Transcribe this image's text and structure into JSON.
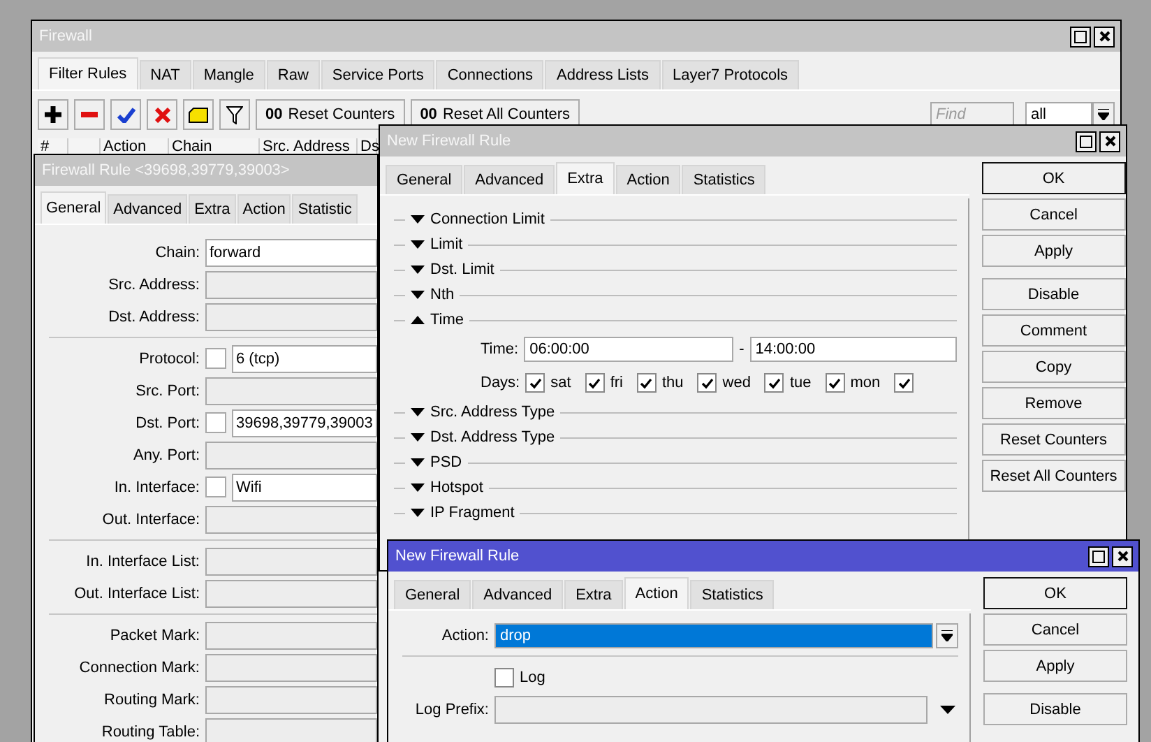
{
  "firewall": {
    "title": "Firewall",
    "tabs": [
      {
        "label": "Filter Rules",
        "selected": true
      },
      {
        "label": "NAT",
        "selected": false
      },
      {
        "label": "Mangle",
        "selected": false
      },
      {
        "label": "Raw",
        "selected": false
      },
      {
        "label": "Service Ports",
        "selected": false
      },
      {
        "label": "Connections",
        "selected": false
      },
      {
        "label": "Address Lists",
        "selected": false
      },
      {
        "label": "Layer7 Protocols",
        "selected": false
      }
    ],
    "toolbar": [
      {
        "kind": "add"
      },
      {
        "kind": "remove"
      },
      {
        "kind": "enable"
      },
      {
        "kind": "disable"
      },
      {
        "kind": "comment"
      },
      {
        "kind": "filter"
      },
      {
        "kind": "text",
        "icon_text": "00",
        "label": "Reset Counters"
      },
      {
        "kind": "text",
        "icon_text": "00",
        "label": "Reset All Counters"
      }
    ],
    "search": {
      "placeholder": "Find"
    },
    "filter_select": {
      "value": "all"
    },
    "table": {
      "columns": [
        "#",
        "Action",
        "Chain",
        "Src. Address",
        "Ds"
      ]
    }
  },
  "rule_window": {
    "title": "Firewall Rule <39698,39779,39003>",
    "tabs": [
      {
        "label": "General",
        "selected": true
      },
      {
        "label": "Advanced",
        "selected": false
      },
      {
        "label": "Extra",
        "selected": false
      },
      {
        "label": "Action",
        "selected": false
      },
      {
        "label": "Statistic",
        "selected": false
      }
    ],
    "groups": [
      [
        {
          "label": "Chain:",
          "value": "forward"
        },
        {
          "label": "Src. Address:"
        },
        {
          "label": "Dst. Address:"
        }
      ],
      [
        {
          "label": "Protocol:",
          "negated": false,
          "value": "6 (tcp)"
        },
        {
          "label": "Src. Port:"
        },
        {
          "label": "Dst. Port:",
          "negated": false,
          "value": "39698,39779,39003"
        },
        {
          "label": "Any. Port:"
        },
        {
          "label": "In. Interface:",
          "negated": false,
          "value": "Wifi"
        },
        {
          "label": "Out. Interface:"
        }
      ],
      [
        {
          "label": "In. Interface List:"
        },
        {
          "label": "Out. Interface List:"
        }
      ],
      [
        {
          "label": "Packet Mark:"
        },
        {
          "label": "Connection Mark:"
        },
        {
          "label": "Routing Mark:"
        },
        {
          "label": "Routing Table:"
        }
      ]
    ]
  },
  "extra_window": {
    "title": "New Firewall Rule",
    "tabs": [
      {
        "label": "General",
        "selected": false
      },
      {
        "label": "Advanced",
        "selected": false
      },
      {
        "label": "Extra",
        "selected": true
      },
      {
        "label": "Action",
        "selected": false
      },
      {
        "label": "Statistics",
        "selected": false
      }
    ],
    "sections": [
      {
        "label": "Connection Limit",
        "expanded": false
      },
      {
        "label": "Limit",
        "expanded": false
      },
      {
        "label": "Dst. Limit",
        "expanded": false
      },
      {
        "label": "Nth",
        "expanded": false
      },
      {
        "label": "Time",
        "expanded": true,
        "time": {
          "label": "Time:",
          "from": "06:00:00",
          "separator": "-",
          "to": "14:00:00"
        },
        "days": {
          "label": "Days:",
          "items": [
            {
              "label": "sat",
              "checked": true
            },
            {
              "label": "fri",
              "checked": true
            },
            {
              "label": "thu",
              "checked": true
            },
            {
              "label": "wed",
              "checked": true
            },
            {
              "label": "tue",
              "checked": true
            },
            {
              "label": "mon",
              "checked": true
            },
            {
              "checked": true
            }
          ]
        }
      },
      {
        "label": "Src. Address Type",
        "expanded": false
      },
      {
        "label": "Dst. Address Type",
        "expanded": false
      },
      {
        "label": "PSD",
        "expanded": false
      },
      {
        "label": "Hotspot",
        "expanded": false
      },
      {
        "label": "IP Fragment",
        "expanded": false
      }
    ],
    "button_groups": [
      [
        {
          "label": "OK",
          "default": true
        },
        {
          "label": "Cancel",
          "default": false
        },
        {
          "label": "Apply",
          "default": false
        }
      ],
      [
        {
          "label": "Disable",
          "default": false
        },
        {
          "label": "Comment",
          "default": false
        },
        {
          "label": "Copy",
          "default": false
        },
        {
          "label": "Remove",
          "default": false
        },
        {
          "label": "Reset Counters",
          "default": false
        },
        {
          "label": "Reset All Counters",
          "default": false
        }
      ]
    ]
  },
  "action_window": {
    "title": "New Firewall Rule",
    "active": true,
    "tabs": [
      {
        "label": "General",
        "selected": false
      },
      {
        "label": "Advanced",
        "selected": false
      },
      {
        "label": "Extra",
        "selected": false
      },
      {
        "label": "Action",
        "selected": true
      },
      {
        "label": "Statistics",
        "selected": false
      }
    ],
    "action": {
      "label": "Action:",
      "value": "drop",
      "highlighted": true
    },
    "log": {
      "label": "Log",
      "checked": false
    },
    "log_prefix": {
      "label": "Log Prefix:"
    },
    "button_groups": [
      [
        {
          "label": "OK",
          "default": true
        },
        {
          "label": "Cancel",
          "default": false
        },
        {
          "label": "Apply",
          "default": false
        }
      ],
      [
        {
          "label": "Disable",
          "default": false
        }
      ]
    ]
  }
}
